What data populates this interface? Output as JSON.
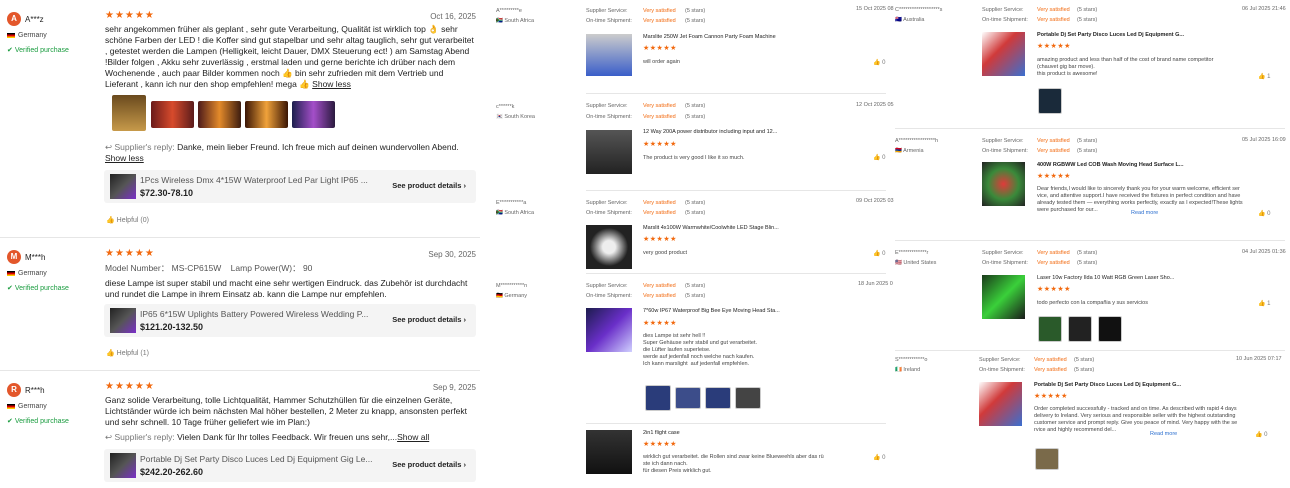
{
  "left_reviews": [
    {
      "initial": "A",
      "name": "A***z",
      "country": "Germany",
      "verified": "Verified purchase",
      "date": "Oct 16, 2025",
      "text": "sehr angekommen früher als geplant , sehr gute Verarbeitung, Qualität ist wirklich top 👌 sehr schöne Farben der LED ! die Koffer sind gut stapelbar und sehr altag tauglich, sehr gut verarbeitet , getestet werden die Lampen (Helligkeit, leicht Dauer, DMX Steuerung ect! ) am Samstag Abend !Bilder folgen , Akku sehr zuverlässig , erstmal laden und gerne berichte ich drüber nach dem Wochenende , auch paar Bilder kommen noch 👍 bin sehr zufrieden mit dem Vertrieb und Lieferant , kann ich nur den shop empfehlen! mega 👍",
      "show_less": "Show less",
      "reply_label": "Supplier's reply:",
      "reply": "Danke, mein lieber Freund. Ich freue mich auf deinen wundervollen Abend.",
      "reply_show": "Show less",
      "product": "1Pcs Wireless Dmx 4*15W Waterproof Led Par Light IP65 ...",
      "price": "$72.30-78.10",
      "see": "See product details",
      "helpful": "Helpful (0)"
    },
    {
      "initial": "M",
      "name": "M***h",
      "country": "Germany",
      "verified": "Verified purchase",
      "date": "Sep 30, 2025",
      "model_label": "Model Number：",
      "model": "MS-CP615W",
      "power_label": "Lamp Power(W)：",
      "power": "90",
      "text": "diese Lampe ist super stabil und macht eine sehr wertigen Eindruck. das Zubehör ist durchdacht und rundet die Lampe in ihrem Einsatz ab. kann die Lampe nur empfehlen.",
      "product": "IP65 6*15W Uplights Battery Powered Wireless Wedding P...",
      "price": "$121.20-132.50",
      "see": "See product details",
      "helpful": "Helpful (1)"
    },
    {
      "initial": "R",
      "name": "R***h",
      "country": "Germany",
      "verified": "Verified purchase",
      "date": "Sep 9, 2025",
      "text": "Ganz solide Verarbeitung, tolle Lichtqualität, Hammer Schutzhüllen für die einzelnen Geräte, Lichtständer würde ich beim nächsten Mal höher bestellen, 2 Meter zu knapp, ansonsten perfekt und sehr schnell. 10 Tage früher geliefert wie im Plan:)",
      "reply_label": "Supplier's reply:",
      "reply": "Vielen Dank für Ihr tolles Feedback. Wir freuen uns sehr,...",
      "reply_show": "Show all",
      "product": "Portable Dj Set Party Disco Luces Led Dj Equipment Gig Le...",
      "price": "$242.20-262.60",
      "see": "See product details"
    }
  ],
  "stars": "★★★★★",
  "labels": {
    "service": "Supplier Service:",
    "shipment": "On-time Shipment:",
    "very": "Very satisfied",
    "five": "(5 stars)",
    "read_more": "Read more"
  },
  "mid_reviews": [
    {
      "name": "A*********e",
      "country": "South Africa",
      "date": "15 Oct 2025 08",
      "product": "Marslite 250W Jet Foam Cannon Party Foam Machine",
      "text": "will order again",
      "likes": "0"
    },
    {
      "name": "c******k",
      "country": "South Korea",
      "date": "12 Oct 2025 05",
      "product": "12 Way 200A power distributor including input and 12...",
      "text": "The product is very good I like it so much.",
      "likes": "0"
    },
    {
      "name": "E***********a",
      "country": "South Africa",
      "date": "09 Oct 2025 03",
      "product": "Marslit 4x100W Warmwhite/Coolwhite LED Stage Blin...",
      "text": "very good product",
      "likes": "0"
    },
    {
      "name": "M***********n",
      "country": "Germany",
      "date": "18 Jun 2025 0",
      "product": "7*60w IP67 Waterproof Big Bee Eye Moving Head Sta...",
      "text": "dies Lampe ist sehr hell !!\nSuper Gehäuse sehr stabil und gut verarbeitet.\ndie Lüfter laufen superleise.\nwerde auf jedenfall noch welche nach kaufen.\nIch kann marslight  auf jedenfall empfehlen.",
      "likes": ""
    },
    {
      "product": "2in1 flight case",
      "text": "wirklich gut verarbeitet. die Rollen sind zwar keine Blueweehls aber das rü\nste ich dann nach.\nfür diesen Preis wirklich gut.",
      "likes": "0"
    }
  ],
  "right_reviews": [
    {
      "name": "C*******************s",
      "country": "Australia",
      "date": "06 Jul 2025 21:46",
      "product": "Portable Dj Set Party Disco Luces Led Dj Equipment G...",
      "text": "amazing product and less than half of the cost of brand name competitor\n(chauvet gig bar move).\nthis product is awesome!",
      "likes": "1"
    },
    {
      "name": "A*****************h",
      "country": "Armenia",
      "date": "05 Jul 2025 16:09",
      "product": "400W RGBWW Led COB Wash Moving Head Surface L...",
      "text": "Dear friends,I would like to sincerely thank you for your warm welcome, efficient ser\nvice, and attentive support.I have received the fixtures in perfect condition and have\nalready tested them — everything works perfectly, exactly as I expected!These lights\nwere purchased for our...",
      "likes": "0"
    },
    {
      "name": "E*************r",
      "country": "United States",
      "date": "04 Jul 2025 01:36",
      "product": "Laser 10w Factory Ilda 10 Watt RGB Green Laser Sho...",
      "text": "todo perfecto con la compañia y sus servicios",
      "likes": "1"
    },
    {
      "name": "S************o",
      "country": "Ireland",
      "date": "10 Jun 2025 07:17",
      "product": "Portable Dj Set Party Disco Luces Led Dj Equipment G...",
      "text": "Order completed successfully - tracked and on time. As described with rapid 4 days\ndelivery to Ireland. Very serious and responsible seller with the highest outstanding\ncustomer service and prompt reply. Give you peace of mind. Very happy with the se\nrvice and highly recommend del...",
      "likes": "0"
    }
  ]
}
